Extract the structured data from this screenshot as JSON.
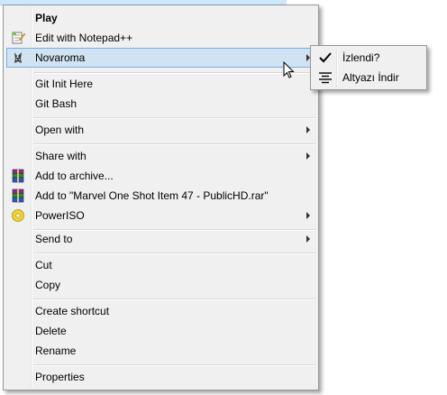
{
  "menu": {
    "items": [
      {
        "label": "Play",
        "icon": "",
        "bold": true
      },
      {
        "label": "Edit with Notepad++",
        "icon": "notepad-plus-plus-icon"
      },
      {
        "label": "Novaroma",
        "icon": "novaroma-icon",
        "submenu": true,
        "highlighted": true
      },
      {
        "label": "Git Init Here",
        "icon": ""
      },
      {
        "label": "Git Bash",
        "icon": ""
      },
      {
        "label": "Open with",
        "icon": "",
        "submenu": true
      },
      {
        "label": "Share with",
        "icon": "",
        "submenu": true
      },
      {
        "label": "Add to archive...",
        "icon": "winrar-icon"
      },
      {
        "label": "Add to \"Marvel One Shot Item 47 - PublicHD.rar\"",
        "icon": "winrar-icon"
      },
      {
        "label": "PowerISO",
        "icon": "poweriso-icon",
        "submenu": true
      },
      {
        "label": "Send to",
        "icon": "",
        "submenu": true
      },
      {
        "label": "Cut",
        "icon": ""
      },
      {
        "label": "Copy",
        "icon": ""
      },
      {
        "label": "Create shortcut",
        "icon": ""
      },
      {
        "label": "Delete",
        "icon": ""
      },
      {
        "label": "Rename",
        "icon": ""
      },
      {
        "label": "Properties",
        "icon": ""
      }
    ]
  },
  "submenu": {
    "items": [
      {
        "label": "İzlendi?",
        "icon": "checkmark-icon"
      },
      {
        "label": "Altyazı İndir",
        "icon": "subtitle-lines-icon"
      }
    ]
  },
  "colors": {
    "menu_background": "#f0f0f0",
    "highlight_background": "#d1e2f2",
    "highlight_border": "#78aee5",
    "menu_border": "#979797"
  }
}
